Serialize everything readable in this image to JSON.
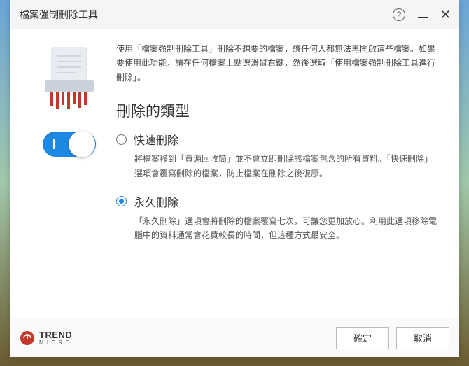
{
  "window": {
    "title": "檔案強制刪除工具"
  },
  "intro": "使用「檔案強制刪除工具」刪除不想要的檔案，讓任何人都無法再開啟這些檔案。如果要使用此功能，請在任何檔案上點選滑鼠右鍵，然後選取「使用檔案強制刪除工具進行刪除」。",
  "section_title": "刪除的類型",
  "options": {
    "quick": {
      "label": "快速刪除",
      "desc": "將檔案移到「資源回收筒」並不會立即刪除該檔案包含的所有資料。「快速刪除」選項會覆寫刪除的檔案，防止檔案在刪除之後復原。",
      "checked": false
    },
    "permanent": {
      "label": "永久刪除",
      "desc": "「永久刪除」選項會將刪除的檔案覆寫七次，可讓您更加放心。利用此選項移除電腦中的資料通常會花費較長的時間，但這種方式最安全。",
      "checked": true
    }
  },
  "brand": {
    "main": "TREND",
    "sub": "M I C R O"
  },
  "footer": {
    "ok": "確定",
    "cancel": "取消"
  },
  "help_symbol": "?",
  "close_symbol": "✕"
}
